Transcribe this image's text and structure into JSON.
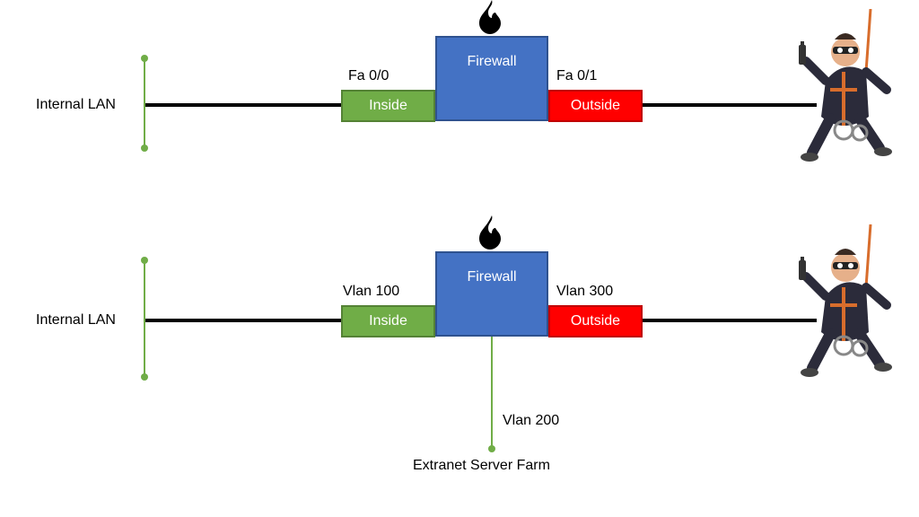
{
  "diagram_top": {
    "lan_label": "Internal LAN",
    "left_port": "Fa 0/0",
    "right_port": "Fa 0/1",
    "firewall_label": "Firewall",
    "inside_label": "Inside",
    "outside_label": "Outside"
  },
  "diagram_bottom": {
    "lan_label": "Internal LAN",
    "left_port": "Vlan 100",
    "right_port": "Vlan 300",
    "down_port": "Vlan 200",
    "firewall_label": "Firewall",
    "inside_label": "Inside",
    "outside_label": "Outside",
    "extranet_label": "Extranet Server Farm"
  },
  "colors": {
    "firewall": "#4472c4",
    "inside": "#70ad47",
    "outside": "#ff0000",
    "lan_line": "#70ad47",
    "link_line": "#000000"
  }
}
